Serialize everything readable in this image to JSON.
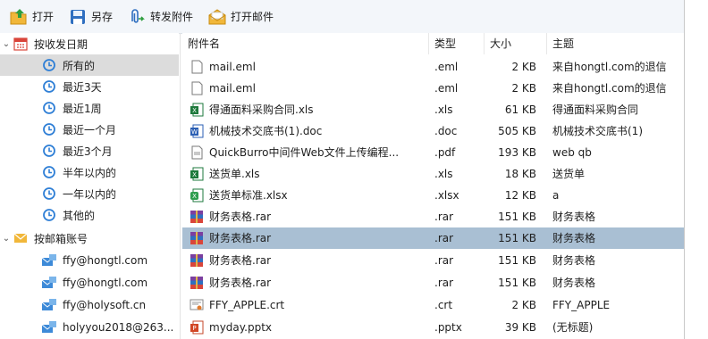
{
  "toolbar": {
    "open_label": "打开",
    "saveas_label": "另存",
    "forward_label": "转发附件",
    "openmail_label": "打开邮件"
  },
  "tree": {
    "by_date_label": "按收发日期",
    "date_items": [
      {
        "label": "所有的",
        "selected": true
      },
      {
        "label": "最近3天"
      },
      {
        "label": "最近1周"
      },
      {
        "label": "最近一个月"
      },
      {
        "label": "最近3个月"
      },
      {
        "label": "半年以内的"
      },
      {
        "label": "一年以内的"
      },
      {
        "label": "其他的"
      }
    ],
    "by_account_label": "按邮箱账号",
    "accounts": [
      {
        "label": "ffy@hongtl.com"
      },
      {
        "label": "ffy@hongtl.com"
      },
      {
        "label": "ffy@holysoft.cn"
      },
      {
        "label": "holyyou2018@263..."
      }
    ]
  },
  "list": {
    "columns": {
      "name": "附件名",
      "type": "类型",
      "size": "大小",
      "subject": "主题"
    },
    "rows": [
      {
        "name": "mail.eml",
        "type": ".eml",
        "size": "2 KB",
        "subject": "来自hongtl.com的退信",
        "icon": "eml-icon"
      },
      {
        "name": "mail.eml",
        "type": ".eml",
        "size": "2 KB",
        "subject": "来自hongtl.com的退信",
        "icon": "eml-icon"
      },
      {
        "name": "得通面料采购合同.xls",
        "type": ".xls",
        "size": "61 KB",
        "subject": "得通面料采购合同",
        "icon": "xls-icon"
      },
      {
        "name": "机械技术交底书(1).doc",
        "type": ".doc",
        "size": "505 KB",
        "subject": "机械技术交底书(1)",
        "icon": "doc-icon"
      },
      {
        "name": "QuickBurro中间件Web文件上传编程...",
        "type": ".pdf",
        "size": "193 KB",
        "subject": "web qb",
        "icon": "pdf-icon"
      },
      {
        "name": "送货单.xls",
        "type": ".xls",
        "size": "18 KB",
        "subject": "送货单",
        "icon": "xls-icon"
      },
      {
        "name": "送货单标准.xlsx",
        "type": ".xlsx",
        "size": "12 KB",
        "subject": "a",
        "icon": "xlsx-icon"
      },
      {
        "name": "财务表格.rar",
        "type": ".rar",
        "size": "151 KB",
        "subject": "财务表格",
        "icon": "rar-icon"
      },
      {
        "name": "财务表格.rar",
        "type": ".rar",
        "size": "151 KB",
        "subject": "财务表格",
        "icon": "rar-icon",
        "selected": true
      },
      {
        "name": "财务表格.rar",
        "type": ".rar",
        "size": "151 KB",
        "subject": "财务表格",
        "icon": "rar-icon"
      },
      {
        "name": "财务表格.rar",
        "type": ".rar",
        "size": "151 KB",
        "subject": "财务表格",
        "icon": "rar-icon"
      },
      {
        "name": "FFY_APPLE.crt",
        "type": ".crt",
        "size": "2 KB",
        "subject": "FFY_APPLE",
        "icon": "crt-icon"
      },
      {
        "name": "myday.pptx",
        "type": ".pptx",
        "size": "39 KB",
        "subject": "(无标题)",
        "icon": "pptx-icon"
      }
    ]
  },
  "colors": {
    "selected_row": "#a9bfd3",
    "selected_tree": "#dcdcdc",
    "clock_blue": "#2f7fd6",
    "calendar_red": "#d9453b"
  }
}
